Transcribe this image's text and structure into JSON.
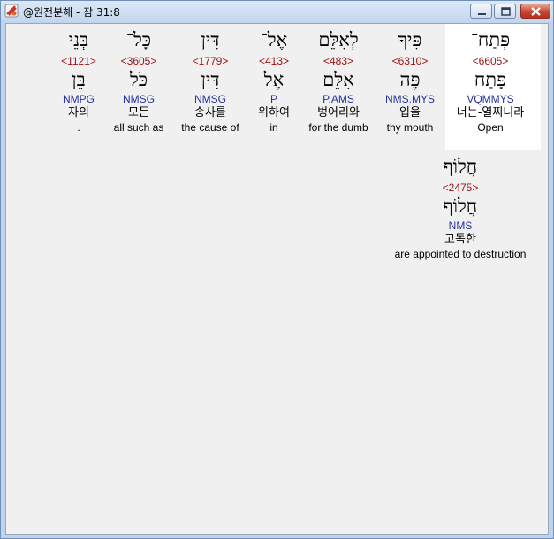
{
  "window": {
    "title": "@원전분해 - 잠 31:8",
    "controls": {
      "minimize": "minimize",
      "maximize": "maximize",
      "close": "close"
    }
  },
  "words": [
    {
      "hebrew": "פְּתַח־",
      "strong": "<6605>",
      "lemma": "פָּתַח",
      "parse": "VQMMYS",
      "korean": "너는-열찌니라",
      "english": "Open"
    },
    {
      "hebrew": "פִּיךָ",
      "strong": "<6310>",
      "lemma": "פֶּה",
      "parse": "NMS.MYS",
      "korean": "입을",
      "english": "thy mouth"
    },
    {
      "hebrew": "לְאִלֵּם",
      "strong": "<483>",
      "lemma": "אִלֵּם",
      "parse": "P.AMS",
      "korean": "벙어리와",
      "english": "for the dumb"
    },
    {
      "hebrew": "אֶל־",
      "strong": "<413>",
      "lemma": "אֶל",
      "parse": "P",
      "korean": "위하여",
      "english": "in"
    },
    {
      "hebrew": "דִּין",
      "strong": "<1779>",
      "lemma": "דִּין",
      "parse": "NMSG",
      "korean": "송사를",
      "english": "the cause of"
    },
    {
      "hebrew": "כָּל־",
      "strong": "<3605>",
      "lemma": "כֹּל",
      "parse": "NMSG",
      "korean": "모든",
      "english": "all such as"
    },
    {
      "hebrew": "בְּנֵי",
      "strong": "<1121>",
      "lemma": "בֵּן",
      "parse": "NMPG",
      "korean": "자의",
      "english": "."
    },
    {
      "hebrew": "חֲלוֹף",
      "strong": "<2475>",
      "lemma": "חֲלוֹף",
      "parse": "NMS",
      "korean": "고독한",
      "english": "are appointed to destruction"
    }
  ]
}
